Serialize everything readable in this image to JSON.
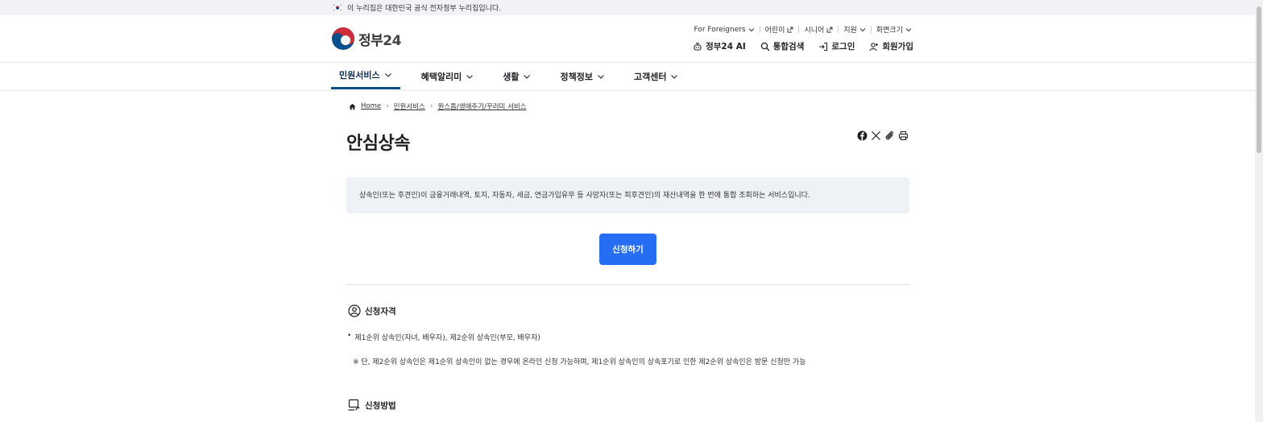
{
  "gov_banner": {
    "text": "이 누리집은 대한민국 공식 전자정부 누리집입니다."
  },
  "logo": {
    "text": "정부",
    "num": "24"
  },
  "util_nav": [
    {
      "label": "For Foreigners",
      "icon": "chevron-down-icon"
    },
    {
      "label": "어린이",
      "icon": "external-link-icon"
    },
    {
      "label": "시니어",
      "icon": "external-link-icon"
    },
    {
      "label": "지원",
      "icon": "chevron-down-icon"
    },
    {
      "label": "화면크기",
      "icon": "chevron-down-icon"
    }
  ],
  "main_actions": {
    "ai": "정부24 AI",
    "search": "통합검색",
    "login": "로그인",
    "join": "회원가입"
  },
  "gnb": [
    "민원서비스",
    "혜택알리미",
    "생활",
    "정책정보",
    "고객센터"
  ],
  "breadcrumb": [
    "Home",
    "민원서비스",
    "원스톱/생애주기/꾸러미 서비스"
  ],
  "page": {
    "title": "안심상속",
    "summary": "상속인(또는 후견인)이 금융거래내역, 토지, 자동차, 세금, 연금가입유무 등 사망자(또는 피후견인)의 재산내역을 한 번에 통합 조회하는 서비스입니다.",
    "apply_label": "신청하기"
  },
  "sections": {
    "eligibility": {
      "title": "신청자격",
      "bullet": "제1순위 상속인(자녀, 배우자), 제2순위 상속인(부모, 배우자)",
      "note": "※ 단, 제2순위 상속인은 제1순위 상속인이 없는 경우에 온라인 신청 가능하며, 제1순위 상속인의 상속포기로 인한 제2순위 상속인은 방문 신청만 가능"
    },
    "method": {
      "title": "신청방법"
    }
  },
  "colors": {
    "primary": "#256ef4",
    "gnb_active": "#0b4e8c",
    "summary_bg": "#eef1f5"
  }
}
